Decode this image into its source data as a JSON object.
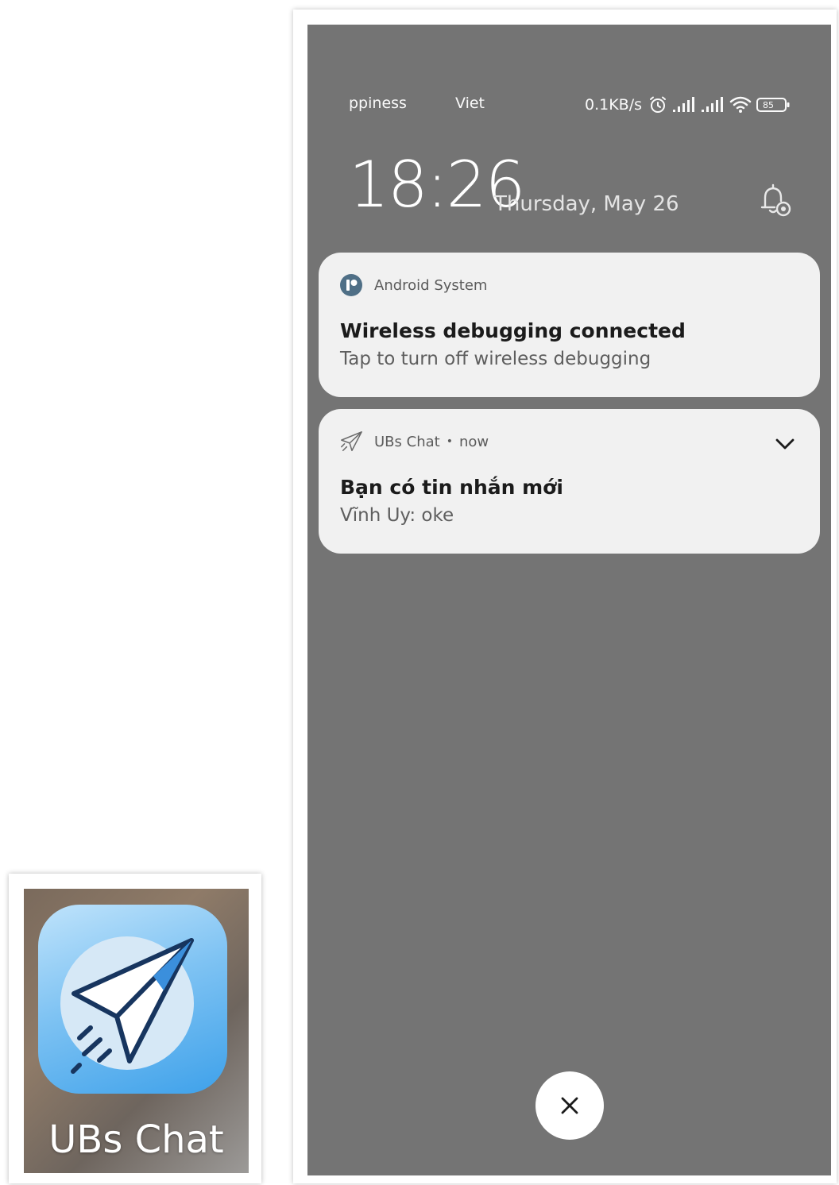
{
  "status_bar": {
    "ticker_left": "ppiness",
    "ticker_right": "Viet",
    "network_speed": "0.1KB/s",
    "battery_level": "85",
    "icons": [
      "alarm-icon",
      "signal-icon",
      "signal-icon",
      "wifi-icon",
      "battery-icon"
    ]
  },
  "lockscreen": {
    "time": "18:26",
    "date": "Thursday, May 26",
    "bell_icon": "notification-settings-icon"
  },
  "notifications": [
    {
      "app_name": "Android System",
      "time": "",
      "title": "Wireless debugging connected",
      "body": "Tap to turn off wireless debugging",
      "icon": "android-system-icon"
    },
    {
      "app_name": "UBs Chat",
      "time": "now",
      "title": "Bạn có tin nhắn mới",
      "body": "Vĩnh Uy: oke",
      "icon": "paper-plane-icon",
      "expand_icon": "chevron-down-icon"
    }
  ],
  "dismiss_button": {
    "icon": "close-icon"
  },
  "app_icon_tile": {
    "label": "UBs Chat",
    "icon": "paper-plane-icon",
    "accent": "#3ea1ea"
  }
}
